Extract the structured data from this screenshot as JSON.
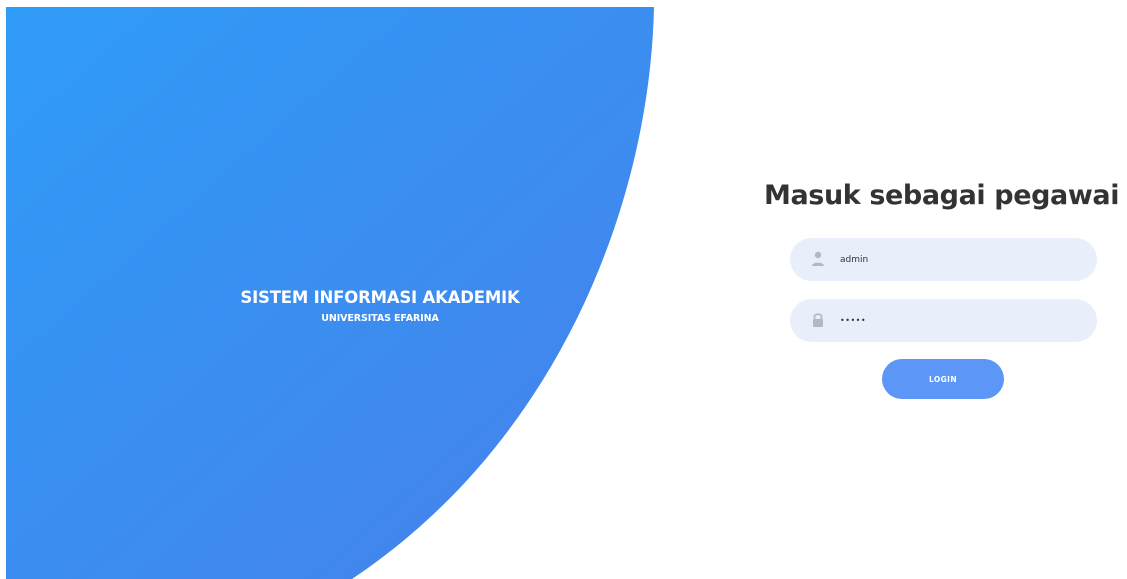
{
  "hero": {
    "title": "SISTEM INFORMASI AKADEMIK",
    "subtitle": "UNIVERSITAS EFARINA",
    "gradient_start": "#2f9cf7",
    "gradient_end": "#4780ea"
  },
  "login": {
    "title": "Masuk sebagai pegawai",
    "username": {
      "icon": "user-icon",
      "value": "admin"
    },
    "password": {
      "icon": "lock-icon",
      "value": "•••••"
    },
    "button_label": "LOGIN"
  },
  "colors": {
    "field_background": "#e9effa",
    "button": "#5c97f7",
    "title_text": "#333333",
    "icon": "#b5b8c0"
  }
}
